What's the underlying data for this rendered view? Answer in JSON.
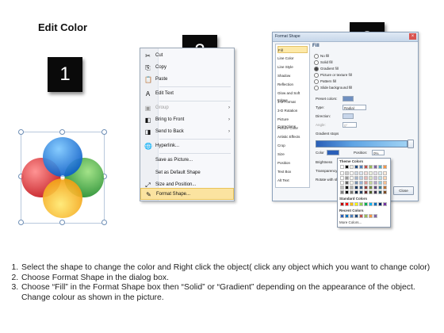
{
  "title": "Edit Color",
  "steps": [
    "1",
    "2",
    "3"
  ],
  "context_menu": {
    "items": [
      {
        "label": "Cut",
        "icon": "scissors-icon",
        "glyph": "✂",
        "state": "normal"
      },
      {
        "label": "Copy",
        "icon": "copy-icon",
        "glyph": "⎘",
        "state": "normal"
      },
      {
        "label": "Paste",
        "icon": "paste-icon",
        "glyph": "📋",
        "state": "normal"
      },
      {
        "label": "Edit Text",
        "icon": "edit-text-icon",
        "glyph": "A",
        "state": "normal"
      },
      {
        "label": "Group",
        "icon": "group-icon",
        "glyph": "▣",
        "state": "disabled",
        "submenu": true
      },
      {
        "label": "Bring to Front",
        "icon": "bring-front-icon",
        "glyph": "◧",
        "state": "normal",
        "submenu": true
      },
      {
        "label": "Send to Back",
        "icon": "send-back-icon",
        "glyph": "◨",
        "state": "normal",
        "submenu": true
      },
      {
        "label": "Hyperlink...",
        "icon": "hyperlink-icon",
        "glyph": "🌐",
        "state": "normal"
      },
      {
        "label": "Save as Picture...",
        "icon": "",
        "glyph": "",
        "state": "normal"
      },
      {
        "label": "Set as Default Shape",
        "icon": "",
        "glyph": "",
        "state": "normal"
      },
      {
        "label": "Size and Position...",
        "icon": "size-position-icon",
        "glyph": "⤢",
        "state": "normal"
      },
      {
        "label": "Format Shape...",
        "icon": "format-shape-icon",
        "glyph": "✎",
        "state": "highlight"
      }
    ],
    "submenu_arrow": "›"
  },
  "format_dialog": {
    "title": "Format Shape",
    "close_glyph": "×",
    "categories": [
      "Fill",
      "Line Color",
      "Line Style",
      "Shadow",
      "Reflection",
      "Glow and Soft Edges",
      "3-D Format",
      "3-D Rotation",
      "Picture Corrections",
      "Picture Color",
      "Artistic Effects",
      "Crop",
      "Size",
      "Position",
      "Text Box",
      "Alt Text"
    ],
    "active_category": "Fill",
    "fill_heading": "Fill",
    "fill_options": [
      {
        "label": "No fill",
        "selected": false
      },
      {
        "label": "Solid fill",
        "selected": false
      },
      {
        "label": "Gradient fill",
        "selected": true
      },
      {
        "label": "Picture or texture fill",
        "selected": false
      },
      {
        "label": "Pattern fill",
        "selected": false
      },
      {
        "label": "Slide background fill",
        "selected": false
      }
    ],
    "fields": [
      {
        "label": "Preset colors:",
        "value": ""
      },
      {
        "label": "Type:",
        "value": "Radial"
      },
      {
        "label": "Direction:",
        "value": ""
      },
      {
        "label": "Angle:",
        "value": "0°"
      },
      {
        "label": "Gradient stops",
        "value": ""
      }
    ],
    "color_label": "Color",
    "position_label": "Position:",
    "position_value": "0%",
    "brightness_label": "Brightness",
    "transparency_label": "Transparency",
    "rotate_label": "Rotate with shape",
    "close_button": "Close"
  },
  "palette": {
    "theme_heading": "Theme Colors",
    "standard_heading": "Standard Colors",
    "recent_heading": "Recent Colors",
    "more_label": "More Colors...",
    "theme_colors": [
      "#ffffff",
      "#000000",
      "#eeece1",
      "#1f497d",
      "#4f81bd",
      "#c0504d",
      "#9bbb59",
      "#8064a2",
      "#4bacc6",
      "#f79646"
    ],
    "standard_colors": [
      "#c00000",
      "#ff0000",
      "#ffc000",
      "#ffff00",
      "#92d050",
      "#00b050",
      "#00b0f0",
      "#0070c0",
      "#002060",
      "#7030a0"
    ],
    "recent_colors": [
      "#2a5fb8",
      "#0070c0",
      "#4f81bd",
      "#1f497d",
      "#c0504d",
      "#9bbb59",
      "#f79646",
      "#8064a2"
    ]
  },
  "shape": {
    "circles": [
      {
        "name": "blue-circle",
        "color": "#1e88e5"
      },
      {
        "name": "red-circle",
        "color": "#e53935"
      },
      {
        "name": "green-circle",
        "color": "#43a047"
      },
      {
        "name": "yellow-circle",
        "color": "#fbc02d"
      }
    ]
  },
  "instructions": [
    "Select the shape to change the color and Right click the object( click any object which you want to change color)",
    "Choose Format Shape in the dialog box.",
    "Choose “Fill” in the Format Shape box then “Solid” or “Gradient” depending on the appearance of the object. Change colour as shown in the picture."
  ]
}
